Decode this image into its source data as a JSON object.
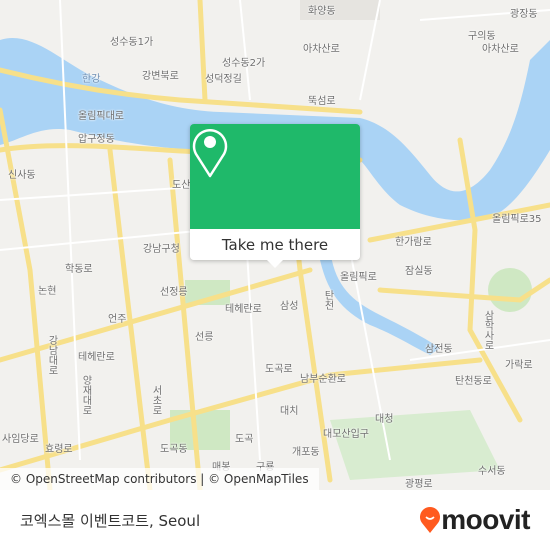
{
  "map": {
    "colors": {
      "water": "#aad3f5",
      "land": "#f2f1ee",
      "road_major": "#f7e08a",
      "park": "#cfe8c3",
      "popup": "#1fb96a"
    },
    "labels": {
      "seongsu1": "성수동1가",
      "seongsu2": "성수동2가",
      "hwayang": "화양동",
      "guui": "구의동",
      "gwangjang": "광장동",
      "hangang": "한강",
      "gangbyeonbukro": "강변북로",
      "seongdeokjeonggil": "성덕정길",
      "ttukseomro": "뚝섬로",
      "achasanro1": "아차산로",
      "achasanro2": "아차산로",
      "olympicro1": "올림픽대로",
      "apgujeong": "압구정동",
      "sinsa": "신사동",
      "dosan": "도산",
      "gangnamgu": "강남구청",
      "hakdongro": "학동로",
      "nonhyeon": "논현",
      "seonjeongneung": "선정릉",
      "eonju": "언주",
      "seolleung": "선릉",
      "teheranro1": "테헤란로",
      "teheranro2": "테헤란로",
      "samseong": "삼성",
      "dogokro": "도곡로",
      "namburo": "남부순환로",
      "daechi": "대치",
      "daemo": "대모산입구",
      "daecheong": "대청",
      "gaepo": "개포동",
      "dogok": "도곡동",
      "maebong": "매봉",
      "guryong": "구룡",
      "dogok2": "도곡",
      "hangaram": "한가람로",
      "jamsil": "잠실동",
      "olympicro2": "올림픽로",
      "olympicro35": "올림픽로35",
      "tancheon": "탄천",
      "samjeon": "삼전동",
      "tancheondong": "탄천동로",
      "garak": "가락로",
      "samhak": "삼학사로",
      "gwangpyeong": "광평로",
      "suseo": "수서동",
      "yangjae": "양재대로",
      "hyoryeong": "효령로",
      "sadang": "사임당로",
      "seocho": "서초로",
      "gangnamdae": "강남대로"
    },
    "popup": {
      "icon": "location-pin-icon",
      "button_label": "Take me there"
    },
    "attribution": "© OpenStreetMap contributors | © OpenMapTiles"
  },
  "footer": {
    "place_name": "코엑스몰 이벤트코트, Seoul",
    "logo_text": "moovit",
    "logo_color": "#ff5a1f"
  }
}
